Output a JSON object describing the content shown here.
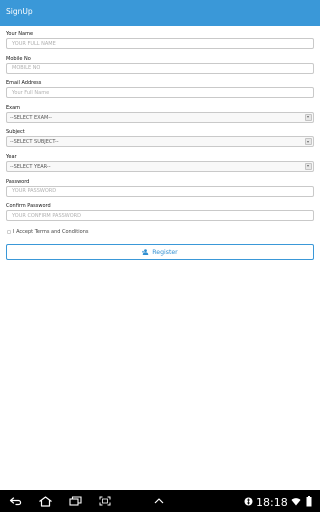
{
  "app_bar": {
    "title": "SignUp"
  },
  "form": {
    "name": {
      "label": "Your Name",
      "placeholder": "YOUR FULL NAME"
    },
    "mobile": {
      "label": "Mobile No",
      "placeholder": "MOBILE NO"
    },
    "email": {
      "label": "Email Address",
      "placeholder": "Your Full Name"
    },
    "exam": {
      "label": "Exam",
      "value": "--SELECT EXAM--"
    },
    "subject": {
      "label": "Subject",
      "value": "--SELECT SUBJECT--"
    },
    "year": {
      "label": "Year",
      "value": "--SELECT YEAR--"
    },
    "password": {
      "label": "Password",
      "placeholder": "YOUR PASSWORD"
    },
    "confirm_password": {
      "label": "Confirm Password",
      "placeholder": "YOUR CONFIRM PASSWORD"
    },
    "terms": {
      "label": "I Accept Terms and Conditions",
      "checked": false
    },
    "register": {
      "label": "Register",
      "icon": "user-add-icon"
    }
  },
  "colors": {
    "accent": "#3a98d8",
    "nav_bar": "#000000"
  },
  "system_bar": {
    "time": "18:18",
    "icons": [
      "back-icon",
      "home-icon",
      "recent-apps-icon",
      "screenshot-icon",
      "menu-up-icon",
      "usb-debug-icon",
      "wifi-icon",
      "battery-icon"
    ]
  }
}
